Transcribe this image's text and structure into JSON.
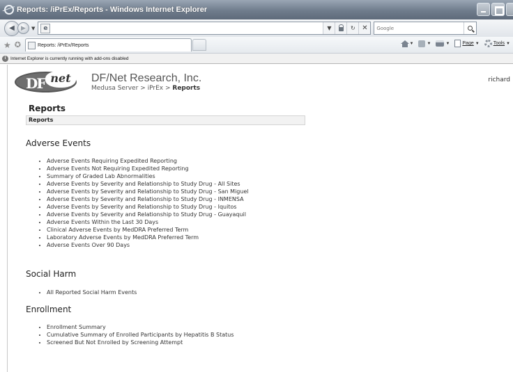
{
  "window": {
    "title": "Reports: /iPrEx/Reports - Windows Internet Explorer"
  },
  "browser": {
    "search_placeholder": "Google",
    "tab_label": "Reports: /iPrEx/Reports",
    "commands": {
      "page_label": "Page",
      "tools_label": "Tools"
    },
    "infobar_text": "Internet Explorer is currently running with add-ons disabled"
  },
  "header": {
    "logo_left": "DF",
    "logo_right": "net",
    "company": "DF/Net Research, Inc.",
    "breadcrumb": {
      "part1": "Medusa Server",
      "sep": ">",
      "part2": "iPrEx",
      "current": "Reports"
    },
    "user": "richard"
  },
  "page": {
    "title": "Reports",
    "section_bar": "Reports"
  },
  "sections": [
    {
      "heading": "Adverse Events",
      "links": [
        "Adverse Events Requiring Expedited Reporting",
        "Adverse Events Not Requiring Expedited Reporting",
        "Summary of Graded Lab Abnormalities",
        "Adverse Events by Severity and Relationship to Study Drug - All Sites",
        "Adverse Events by Severity and Relationship to Study Drug - San Miguel",
        "Adverse Events by Severity and Relationship to Study Drug - INMENSA",
        "Adverse Events by Severity and Relationship to Study Drug - Iquitos",
        "Adverse Events by Severity and Relationship to Study Drug - Guayaquil",
        "Adverse Events Within the Last 30 Days",
        "Clinical Adverse Events by MedDRA Preferred Term",
        "Laboratory Adverse Events by MedDRA Preferred Term",
        "Adverse Events Over 90 Days"
      ]
    },
    {
      "heading": "Social Harm",
      "links": [
        "All Reported Social Harm Events"
      ]
    },
    {
      "heading": "Enrollment",
      "links": [
        "Enrollment Summary",
        "Cumulative Summary of Enrolled Participants by Hepatitis B Status",
        "Screened But Not Enrolled by Screening Attempt"
      ]
    }
  ]
}
